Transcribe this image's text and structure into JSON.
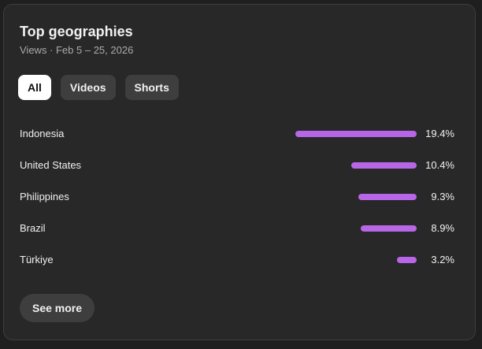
{
  "card": {
    "title": "Top geographies",
    "subtitle": "Views · Feb 5 – 25, 2026"
  },
  "filters": [
    {
      "label": "All",
      "selected": true
    },
    {
      "label": "Videos",
      "selected": false
    },
    {
      "label": "Shorts",
      "selected": false
    }
  ],
  "chart_data": {
    "type": "bar",
    "categories": [
      "Indonesia",
      "United States",
      "Philippines",
      "Brazil",
      "Türkiye"
    ],
    "values": [
      19.4,
      10.4,
      9.3,
      8.9,
      3.2
    ],
    "value_labels": [
      "19.4%",
      "10.4%",
      "9.3%",
      "8.9%",
      "3.2%"
    ],
    "unit": "%",
    "bar_color": "#b766e8"
  },
  "footer": {
    "see_more_label": "See more"
  },
  "colors": {
    "card_background": "#282828",
    "page_background": "#1f1f1f",
    "chip_active_background": "#ffffff",
    "chip_background": "#3e3e3e"
  }
}
